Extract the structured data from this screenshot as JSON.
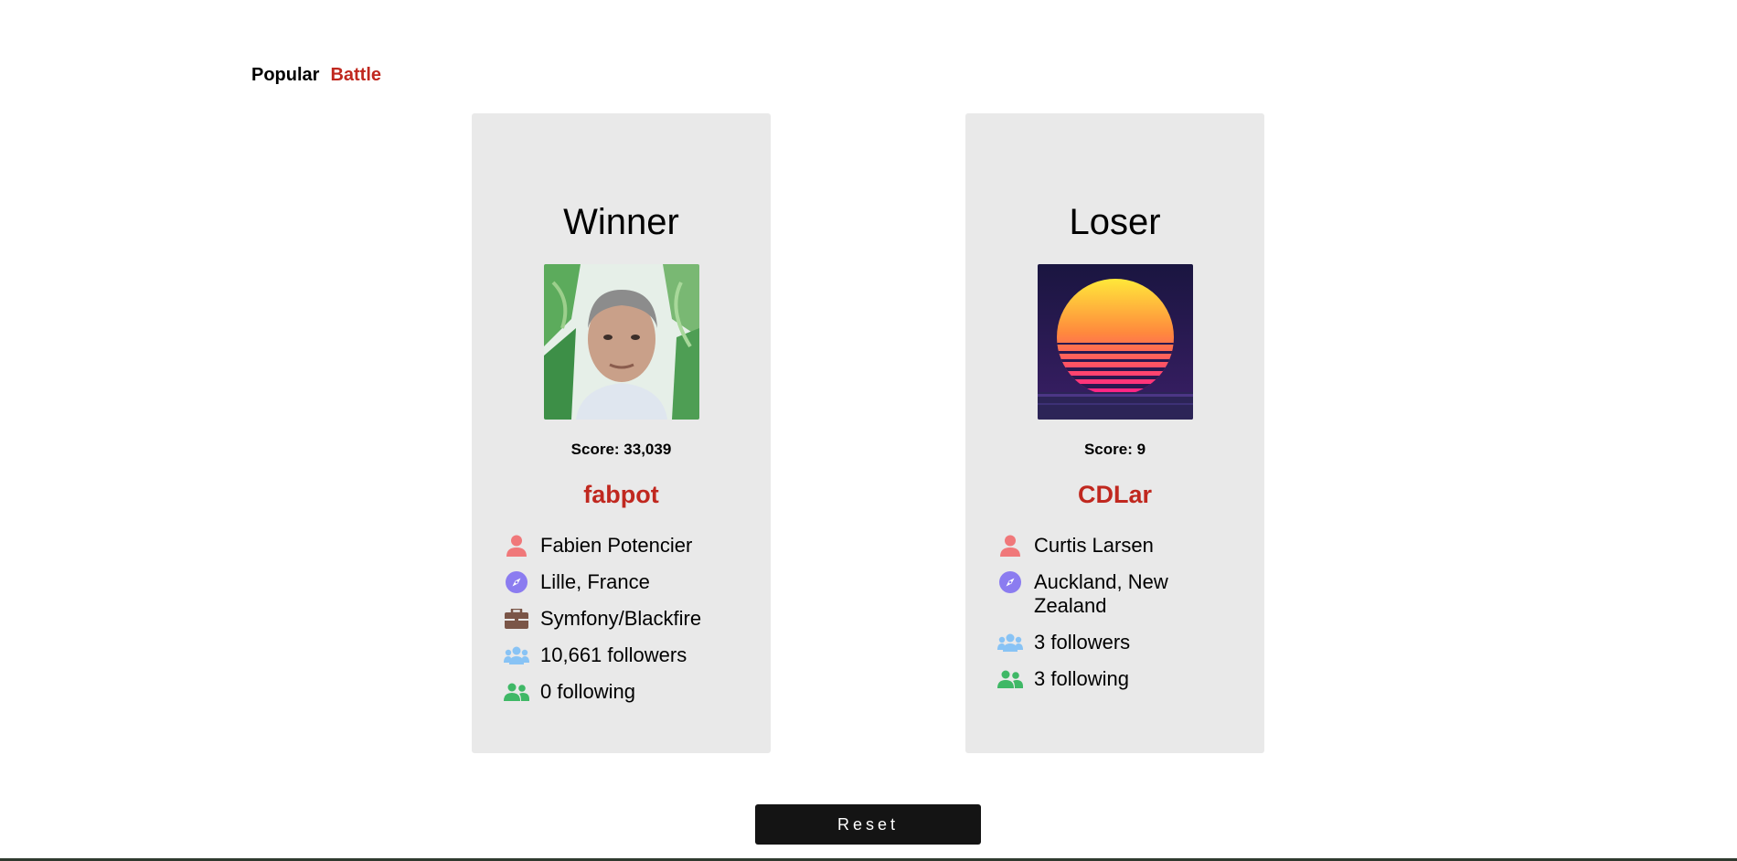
{
  "nav": {
    "items": [
      {
        "label": "Popular",
        "active": false
      },
      {
        "label": "Battle",
        "active": true
      }
    ]
  },
  "players": [
    {
      "result": "Winner",
      "score": "Score: 33,039",
      "username": "fabpot",
      "name": "Fabien Potencier",
      "location": "Lille, France",
      "company": "Symfony/Blackfire",
      "followers": "10,661 followers",
      "following": "0 following"
    },
    {
      "result": "Loser",
      "score": "Score: 9",
      "username": "CDLar",
      "name": "Curtis Larsen",
      "location": "Auckland, New Zealand",
      "followers": "3 followers",
      "following": "3 following"
    }
  ],
  "reset_label": "Reset",
  "colors": {
    "accent": "#c0281f",
    "card_bg": "#e9e9e9",
    "user_icon": "#f0787a",
    "compass_icon": "#8b7cf0",
    "briefcase_icon": "#7a5547",
    "followers_icon": "#88c3f5",
    "following_icon": "#3fb866",
    "button_bg": "#141414"
  },
  "icons": {
    "name": "user-icon",
    "location": "compass-icon",
    "company": "briefcase-icon",
    "followers": "users-icon",
    "following": "user-friends-icon"
  }
}
